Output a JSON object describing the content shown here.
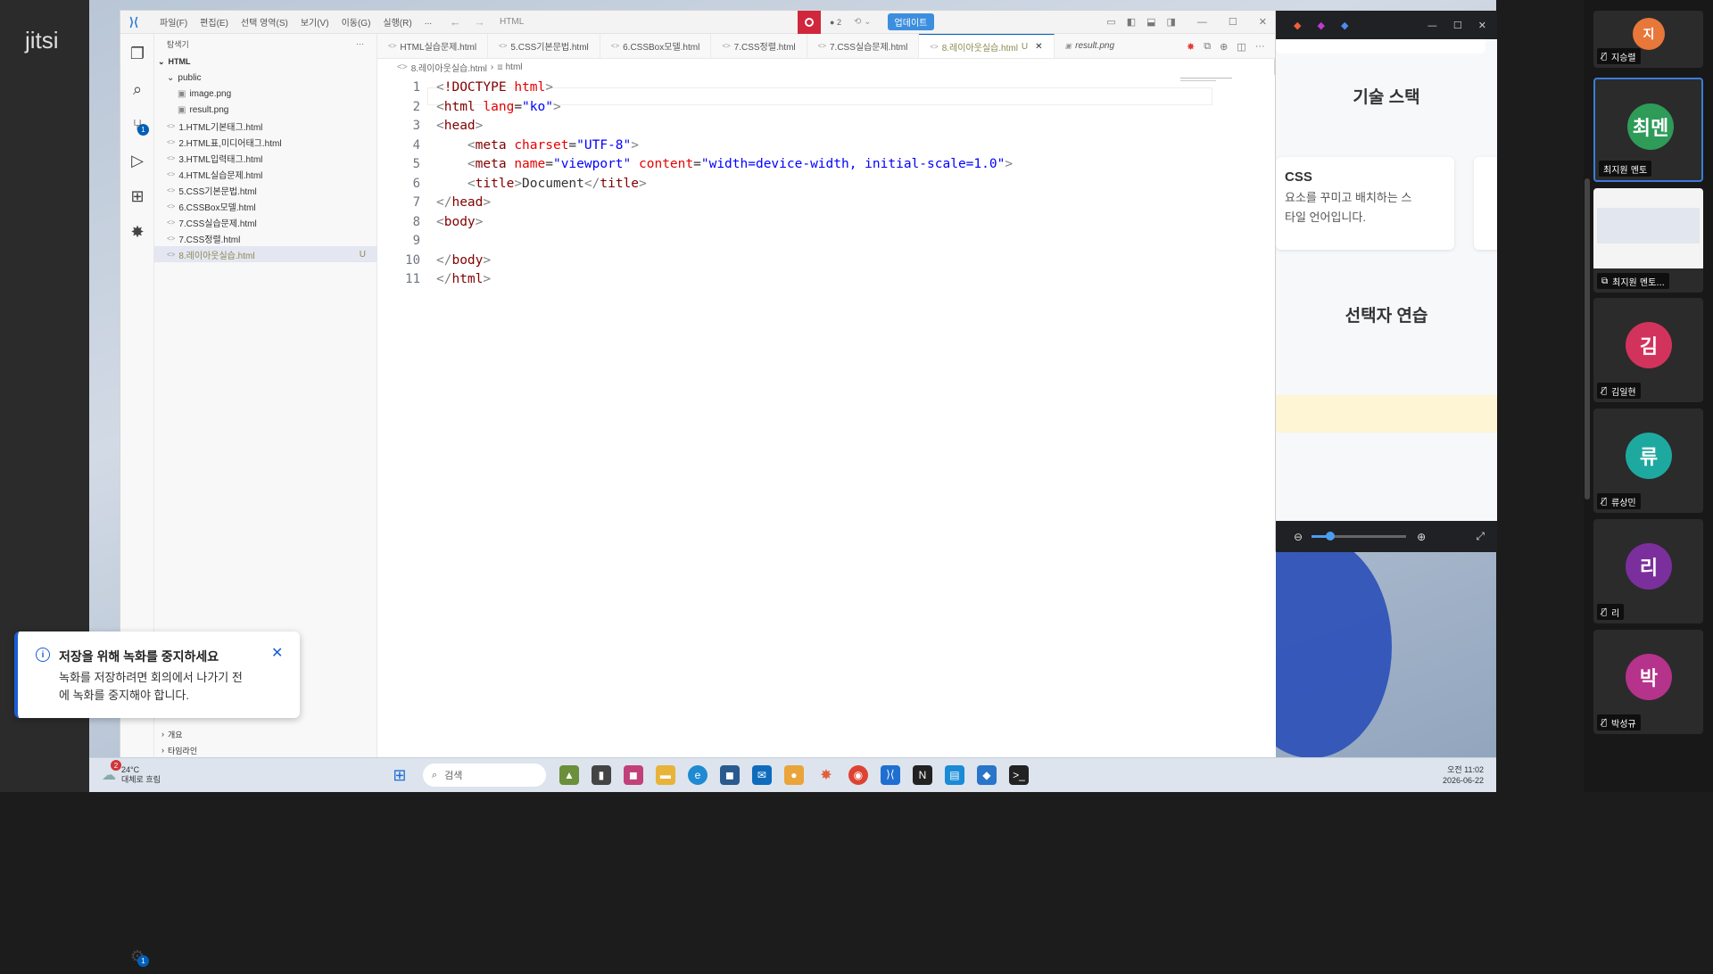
{
  "jitsi": {
    "logo": "jitsi"
  },
  "vscode": {
    "menu": [
      "파일(F)",
      "편집(E)",
      "선택 영역(S)",
      "보기(V)",
      "이동(G)",
      "실행(R)",
      "..."
    ],
    "search_text": "HTML",
    "update_button": "업데이트",
    "record_count": "2"
  },
  "explorer": {
    "title": "탐색기",
    "root": "HTML",
    "folder": "public",
    "folder_files": [
      "image.png",
      "result.png"
    ],
    "files": [
      "1.HTML기본태그.html",
      "2.HTML표,미디어태그.html",
      "3.HTML입력태그.html",
      "4.HTML실습문제.html",
      "5.CSS기본문법.html",
      "6.CSSBox모델.html",
      "7.CSS실습문제.html",
      "7.CSS정렬.html",
      "8.레이아웃실습.html"
    ],
    "selected_status": "U",
    "bottom_sections": [
      "개요",
      "타임라인"
    ],
    "accounts_badge": "1",
    "scm_badge": "1"
  },
  "tabs": [
    {
      "label": "HTML실습문제.html"
    },
    {
      "label": "5.CSS기본문법.html"
    },
    {
      "label": "6.CSSBox모델.html"
    },
    {
      "label": "7.CSS정렬.html"
    },
    {
      "label": "7.CSS실습문제.html"
    },
    {
      "label": "8.레이아웃실습.html",
      "status": "U"
    },
    {
      "label": "result.png"
    }
  ],
  "breadcrumb": [
    "8.레이아웃실습.html",
    "html"
  ],
  "code_lines": [
    {
      "n": "1",
      "html": "<span class=\"g\">&lt;</span><span class=\"t\">!DOCTYPE</span> <span class=\"a\">html</span><span class=\"g\">&gt;</span>"
    },
    {
      "n": "2",
      "html": "<span class=\"g\">&lt;</span><span class=\"t\">html</span> <span class=\"a\">lang</span>=<span class=\"s\">\"ko\"</span><span class=\"g\">&gt;</span>"
    },
    {
      "n": "3",
      "html": "<span class=\"g\">&lt;</span><span class=\"t\">head</span><span class=\"g\">&gt;</span>"
    },
    {
      "n": "4",
      "html": "    <span class=\"g\">&lt;</span><span class=\"t\">meta</span> <span class=\"a\">charset</span>=<span class=\"s\">\"UTF-8\"</span><span class=\"g\">&gt;</span>"
    },
    {
      "n": "5",
      "html": "    <span class=\"g\">&lt;</span><span class=\"t\">meta</span> <span class=\"a\">name</span>=<span class=\"s\">\"viewport\"</span> <span class=\"a\">content</span>=<span class=\"s\">\"width=device-width, initial-scale=1.0\"</span><span class=\"g\">&gt;</span>"
    },
    {
      "n": "6",
      "html": "    <span class=\"g\">&lt;</span><span class=\"t\">title</span><span class=\"g\">&gt;</span>Document<span class=\"g\">&lt;/</span><span class=\"t\">title</span><span class=\"g\">&gt;</span>"
    },
    {
      "n": "7",
      "html": "<span class=\"g\">&lt;/</span><span class=\"t\">head</span><span class=\"g\">&gt;</span>"
    },
    {
      "n": "8",
      "html": "<span class=\"g\">&lt;</span><span class=\"t\">body</span><span class=\"g\">&gt;</span>"
    },
    {
      "n": "9",
      "html": ""
    },
    {
      "n": "10",
      "html": "<span class=\"g\">&lt;/</span><span class=\"t\">body</span><span class=\"g\">&gt;</span>"
    },
    {
      "n": "11",
      "html": "<span class=\"g\">&lt;/</span><span class=\"t\">html</span><span class=\"g\">&gt;</span>"
    }
  ],
  "preview": {
    "section1": "기술 스택",
    "card_title": "CSS",
    "card_text_1": "요소를 꾸미고 배치하는 스",
    "card_text_2": "타일 언어입니다.",
    "section2": "선택자 연습"
  },
  "participants": [
    {
      "initial": "지",
      "name": "지승렬",
      "color": "#e8773a",
      "muted": true
    },
    {
      "initial": "최멘",
      "name": "최지원 멘토",
      "color": "#2e9b59",
      "muted": false,
      "active": true
    },
    {
      "initial": "",
      "name": "최지원 멘토...",
      "color": "#ffffff",
      "muted": false,
      "screen": true
    },
    {
      "initial": "김",
      "name": "김일현",
      "color": "#d2335c",
      "muted": true
    },
    {
      "initial": "류",
      "name": "류상민",
      "color": "#1ea9a0",
      "muted": true
    },
    {
      "initial": "리",
      "name": "리",
      "color": "#7b2f9c",
      "muted": true
    },
    {
      "initial": "박",
      "name": "박성규",
      "color": "#b5338a",
      "muted": true
    }
  ],
  "toast": {
    "title": "저장을 위해 녹화를 중지하세요",
    "body_1": "녹화를 저장하려면 회의에서 나가기 전",
    "body_2": "에 녹화를 중지해야 합니다."
  },
  "taskbar": {
    "weather_temp": "24°C",
    "weather_desc": "대체로 흐림",
    "weather_badge": "2",
    "search_placeholder": "검색",
    "time": "오전 11:02",
    "date": "2026-06-22"
  }
}
